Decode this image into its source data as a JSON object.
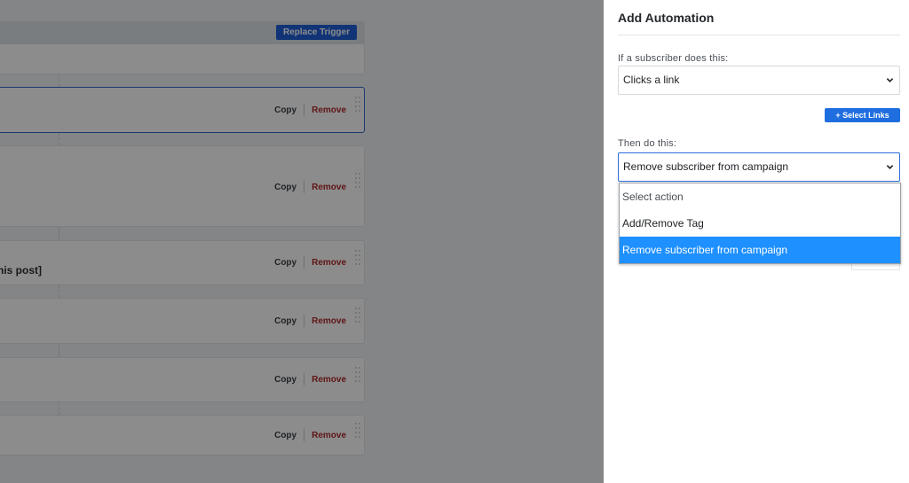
{
  "background": {
    "replace_trigger_label": "Replace Trigger",
    "card_copy_label": "Copy",
    "card_remove_label": "Remove",
    "partial_card_text": "his post]"
  },
  "panel": {
    "title": "Add Automation",
    "trigger": {
      "label": "If a subscriber does this:",
      "value": "Clicks a link"
    },
    "select_links_label": "+ Select Links",
    "action": {
      "label": "Then do this:",
      "value": "Remove subscriber from campaign",
      "options": [
        "Select action",
        "Add/Remove Tag",
        "Remove subscriber from campaign"
      ],
      "selected_index": 2
    }
  },
  "colors": {
    "accent": "#1f6ee0",
    "selected_option": "#1e90ff",
    "remove_link": "#b0292a"
  }
}
